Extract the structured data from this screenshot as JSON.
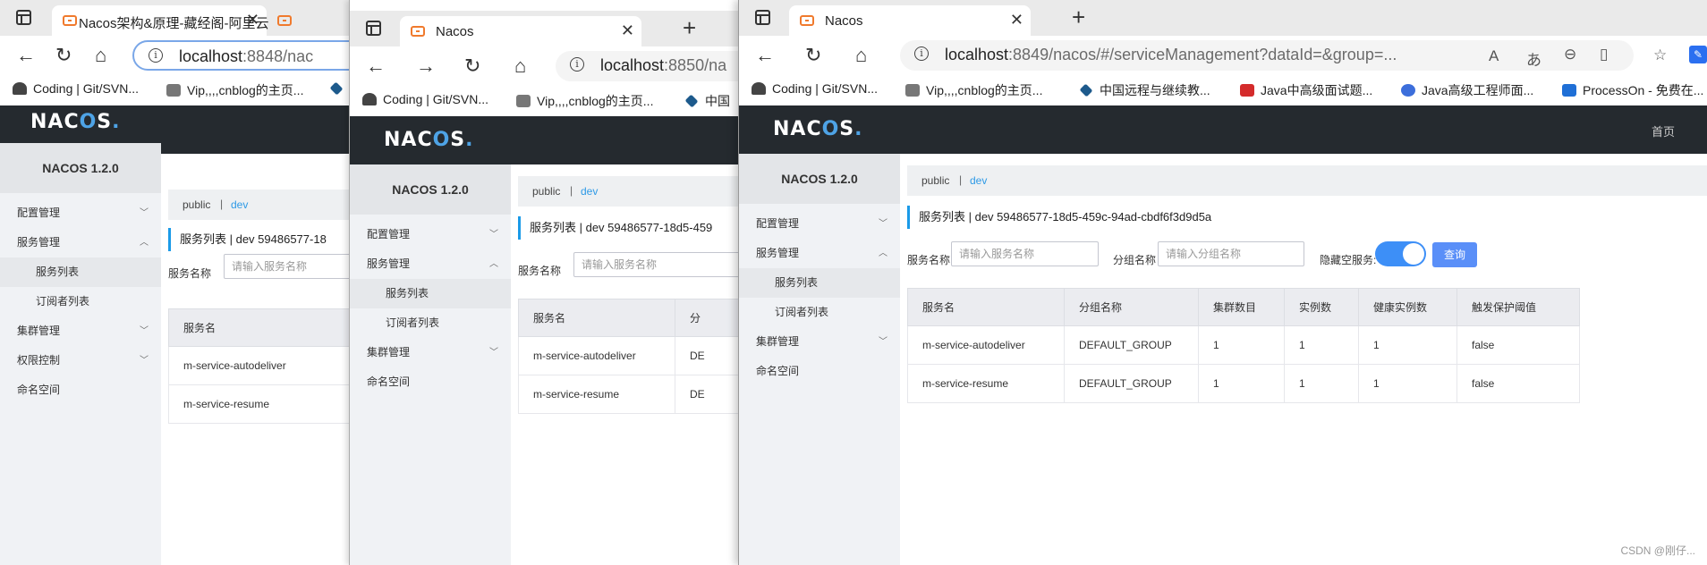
{
  "windows": [
    {
      "tab_title": "Nacos架构&原理-藏经阁-阿里云",
      "url_host": "localhost",
      "url_rest": ":8848/nac",
      "other_tab_icon": "nacos-favicon-icon"
    },
    {
      "tab_title": "Nacos",
      "url_host": "localhost",
      "url_rest": ":8850/na"
    },
    {
      "tab_title": "Nacos",
      "url_host": "localhost",
      "url_rest": ":8849/nacos/#/serviceManagement?dataId=&group=..."
    }
  ],
  "bookmarks": [
    {
      "label": "Coding | Git/SVN...",
      "icon": "coding-icon"
    },
    {
      "label": "Vip,,,,cnblog的主页...",
      "icon": "cnblog-icon"
    },
    {
      "label": "中国远程与继续教...",
      "icon": "diamond-icon"
    },
    {
      "label": "Java中高级面试题...",
      "icon": "csdn-icon"
    },
    {
      "label": "Java高级工程师面...",
      "icon": "gear-icon"
    },
    {
      "label": "ProcessOn - 免费在...",
      "icon": "processon-icon"
    }
  ],
  "bookmark_cut": "中国",
  "nacos": {
    "logo": "NACOS.",
    "home_link": "首页",
    "version": "NACOS 1.2.0",
    "menu": {
      "config": "配置管理",
      "service": "服务管理",
      "service_list": "服务列表",
      "subscribers": "订阅者列表",
      "cluster": "集群管理",
      "permission": "权限控制",
      "namespace": "命名空间"
    },
    "ns_public": "public",
    "ns_sep": "|",
    "ns_dev": "dev",
    "breadcrumb": "服务列表  |  dev  59486577-18d5-459c-94ad-cbdf6f3d9d5a",
    "breadcrumb_w1": "服务列表  |  dev  59486577-18",
    "breadcrumb_w2": "服务列表  |  dev  59486577-18d5-459",
    "filters": {
      "service_name_label": "服务名称",
      "service_name_placeholder": "请输入服务名称",
      "group_name_label": "分组名称",
      "group_name_placeholder": "请输入分组名称",
      "hide_empty_label": "隐藏空服务:",
      "hide_empty_on": true,
      "query_button": "查询"
    },
    "table": {
      "headers": [
        "服务名",
        "分组名称",
        "集群数目",
        "实例数",
        "健康实例数",
        "触发保护阈值"
      ],
      "header_cut": "分",
      "rows": [
        [
          "m-service-autodeliver",
          "DEFAULT_GROUP",
          "1",
          "1",
          "1",
          "false"
        ],
        [
          "m-service-resume",
          "DEFAULT_GROUP",
          "1",
          "1",
          "1",
          "false"
        ]
      ],
      "group_cut": "DE"
    }
  },
  "watermark": "CSDN @刚仔..."
}
